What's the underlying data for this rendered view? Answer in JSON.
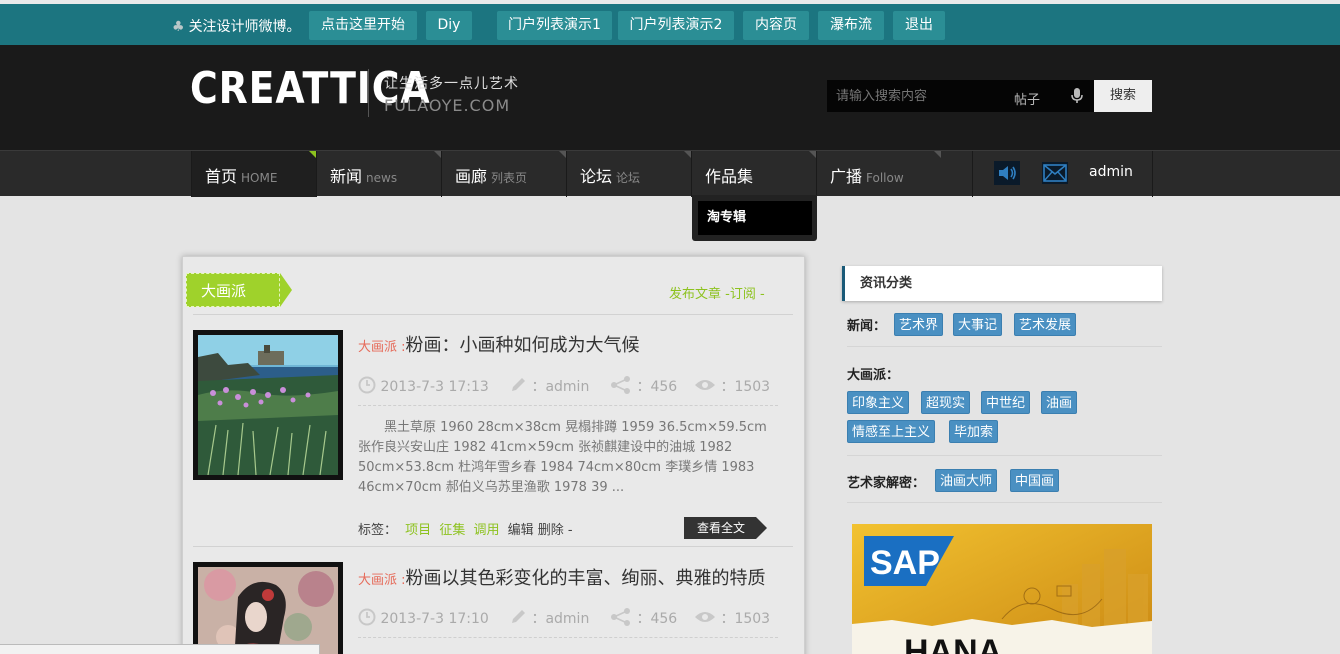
{
  "topbar": {
    "follow_text": "关注设计师微博。",
    "buttons": [
      "点击这里开始",
      "Diy",
      "门户列表演示1",
      "门户列表演示2",
      "内容页",
      "瀑布流",
      "退出"
    ]
  },
  "header": {
    "logo": "CREATTICA",
    "slogan": "让生活多一点儿艺术",
    "domain": "FULAOYE.COM",
    "search": {
      "placeholder": "请输入搜索内容",
      "type": "帖子",
      "button": "搜索"
    }
  },
  "nav": {
    "items": [
      {
        "label": "首页",
        "sub": "HOME"
      },
      {
        "label": "新闻",
        "sub": "news"
      },
      {
        "label": "画廊",
        "sub": "列表页"
      },
      {
        "label": "论坛",
        "sub": "论坛"
      },
      {
        "label": "作品集",
        "sub": ""
      },
      {
        "label": "广播",
        "sub": "Follow"
      }
    ],
    "dropdown_item": "淘专辑",
    "admin": "admin"
  },
  "content": {
    "category": "大画派",
    "links": "发布文章 -订阅 -",
    "posts": [
      {
        "prefix": "大画派 :",
        "title": "粉画：小画种如何成为大气候",
        "date": "2013-7-3 17:13",
        "author": "：admin",
        "shares": "：456",
        "views": "：1503",
        "excerpt": "黑土草原 1960 28cm×38cm 晃榻排蹲 1959 36.5cm×59.5cm 张作良兴安山庄 1982 41cm×59cm 张祯麒建设中的油城 1982 50cm×53.8cm 杜鸿年雪乡春 1984 74cm×80cm 李璞乡情 1983 46cm×70cm 郝伯义乌苏里渔歌 1978 39 ...",
        "tags_label": "标签：",
        "tags": [
          "项目",
          "征集",
          "调用"
        ],
        "actions": "编辑 删除 -",
        "read_more": "查看全文"
      },
      {
        "prefix": "大画派 :",
        "title": "粉画以其色彩变化的丰富、绚丽、典雅的特质",
        "date": "2013-7-3 17:10",
        "author": "：admin",
        "shares": "：456",
        "views": "：1503"
      }
    ]
  },
  "sidebar": {
    "heading": "资讯分类",
    "groups": [
      {
        "label": "新闻：",
        "tags": [
          "艺术界",
          "大事记",
          "艺术发展"
        ]
      },
      {
        "label": "大画派：",
        "tags": [
          "印象主义",
          "超现实",
          "中世纪",
          "油画",
          "情感至上主义",
          "毕加索"
        ]
      },
      {
        "label": "艺术家解密：",
        "tags": [
          "油画大师",
          "中国画"
        ]
      }
    ],
    "ad_brand": "SAP",
    "ad_text": "HANA"
  },
  "colors": {
    "topbar": "#1c7580",
    "accent_green": "#9fd22b",
    "tag_blue": "#4a90c2",
    "title_red": "#e66b5a"
  }
}
